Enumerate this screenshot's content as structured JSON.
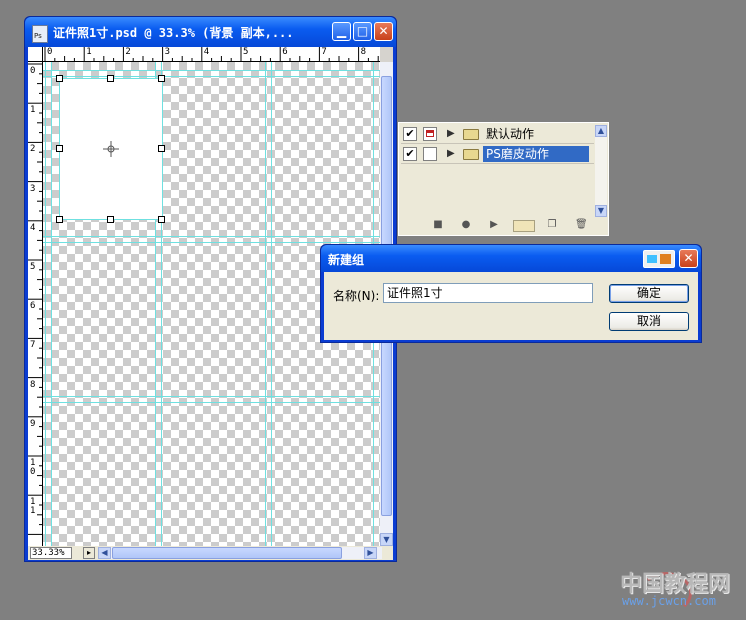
{
  "document_window": {
    "title": "证件照1寸.psd @ 33.3% (背景 副本,...",
    "minimize_glyph": "▁",
    "maximize_glyph": "□",
    "close_glyph": "✕",
    "ruler_h_numbers": [
      "0",
      "1",
      "2",
      "3",
      "4",
      "5",
      "6",
      "7",
      "8"
    ],
    "ruler_v_numbers": [
      "0",
      "1",
      "2",
      "3",
      "4",
      "5",
      "6",
      "7",
      "8",
      "9",
      "1\n0",
      "1\n1"
    ],
    "zoom": "33.33%"
  },
  "actions_panel": {
    "items": [
      {
        "label": "默认动作",
        "checked": true,
        "dialog_toggle": true,
        "selected": false
      },
      {
        "label": "PS磨皮动作",
        "checked": true,
        "dialog_toggle": false,
        "selected": true
      }
    ],
    "toolbar_icons": [
      "stop-icon",
      "record-icon",
      "play-icon",
      "new-set-icon",
      "new-action-icon",
      "delete-icon"
    ]
  },
  "dialog": {
    "title": "新建组",
    "name_label": "名称(N):",
    "name_value": "证件照1寸",
    "ok_label": "确定",
    "cancel_label": "取消",
    "close_glyph": "✕"
  },
  "watermark": {
    "text": "中国教程网",
    "url": "www.jcwcn.com"
  },
  "colors": {
    "desktop": "#808080",
    "title_blue": "#0a5cf0",
    "guide": "#6fe0e0",
    "selection_highlight": "#316ac5"
  }
}
